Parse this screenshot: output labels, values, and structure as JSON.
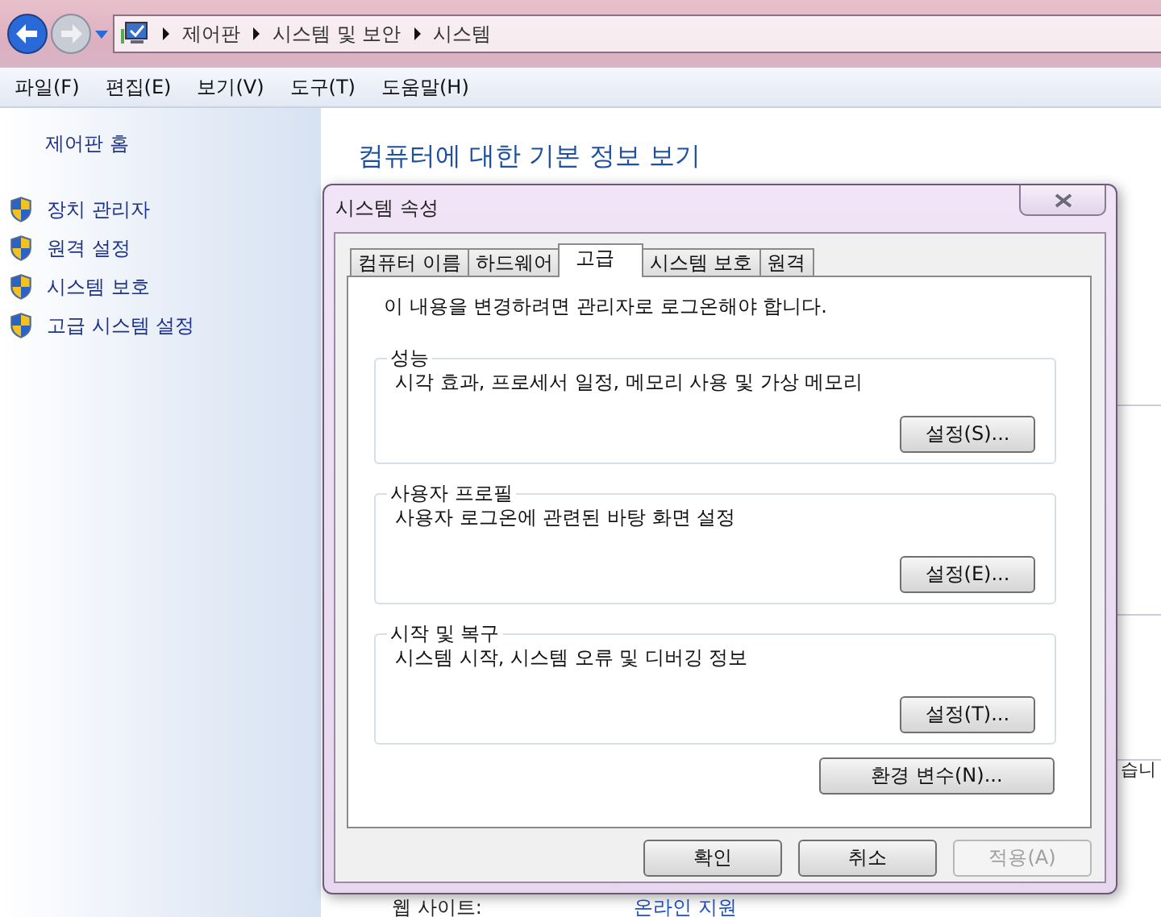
{
  "window": {
    "breadcrumb": [
      "제어판",
      "시스템 및 보안",
      "시스템"
    ]
  },
  "menu": [
    "파일(F)",
    "편집(E)",
    "보기(V)",
    "도구(T)",
    "도움말(H)"
  ],
  "sidebar": {
    "home": "제어판 홈",
    "items": [
      "장치 관리자",
      "원격 설정",
      "시스템 보호",
      "고급 시스템 설정"
    ]
  },
  "content": {
    "title": "컴퓨터에 대한 기본 정보 보기",
    "side_fragment": "습니",
    "website_label": "웹 사이트:",
    "website_link": "온라인 지원"
  },
  "dialog": {
    "title": "시스템 속성",
    "tabs": [
      {
        "label": "컴퓨터 이름",
        "selected": false
      },
      {
        "label": "하드웨어",
        "selected": false
      },
      {
        "label": "고급",
        "selected": true
      },
      {
        "label": "시스템 보호",
        "selected": false
      },
      {
        "label": "원격",
        "selected": false
      }
    ],
    "notice": "이 내용을 변경하려면 관리자로 로그온해야 합니다.",
    "groups": [
      {
        "title": "성능",
        "description": "시각 효과, 프로세서 일정, 메모리 사용 및 가상 메모리",
        "button": "설정(S)..."
      },
      {
        "title": "사용자 프로필",
        "description": "사용자 로그온에 관련된 바탕 화면 설정",
        "button": "설정(E)..."
      },
      {
        "title": "시작 및 복구",
        "description": "시스템 시작, 시스템 오류 및 디버깅 정보",
        "button": "설정(T)..."
      }
    ],
    "env_button": "환경 변수(N)...",
    "buttons": [
      {
        "label": "확인",
        "disabled": false
      },
      {
        "label": "취소",
        "disabled": false
      },
      {
        "label": "적용(A)",
        "disabled": true
      }
    ]
  }
}
